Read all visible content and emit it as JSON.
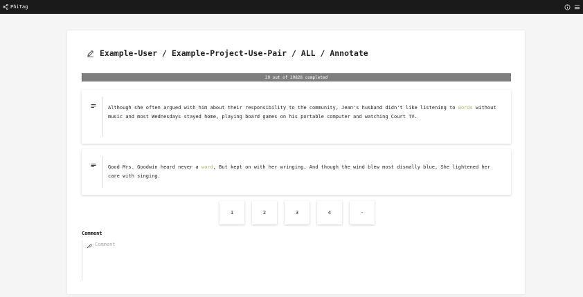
{
  "app": {
    "name": "PhiTag"
  },
  "header": {
    "breadcrumb": "Example-User / Example-Project-Use-Pair / ALL / Annotate"
  },
  "progress": {
    "text": "29 out of 29828 completed",
    "completed": 29,
    "total": 29828
  },
  "sentences": [
    {
      "before": "Although she often argued with him about their responsibility to the community, Jean's husband didn't like listening to ",
      "target": "words",
      "after": " without music and most Wednesdays stayed home, playing board games on his portable computer and watching Court TV."
    },
    {
      "before": "Good Mrs. Goodwin heard never a ",
      "target": "word",
      "after": ", But kept on with her wringing, And though the wind blew most dismally blue, She lightened her care with singing."
    }
  ],
  "labels": [
    "1",
    "2",
    "3",
    "4",
    "-"
  ],
  "comment": {
    "label": "Comment",
    "placeholder": "Comment",
    "value": ""
  },
  "colors": {
    "topbar": "#1a1a1a",
    "progress": "#7f7f7f",
    "highlight": "#a6b96b"
  },
  "icons": {
    "brand": "share-nodes-icon",
    "info": "info-circle-icon",
    "menu": "menu-icon",
    "edit": "pencil-icon",
    "sentence": "align-left-icon",
    "comment": "feather-icon"
  }
}
